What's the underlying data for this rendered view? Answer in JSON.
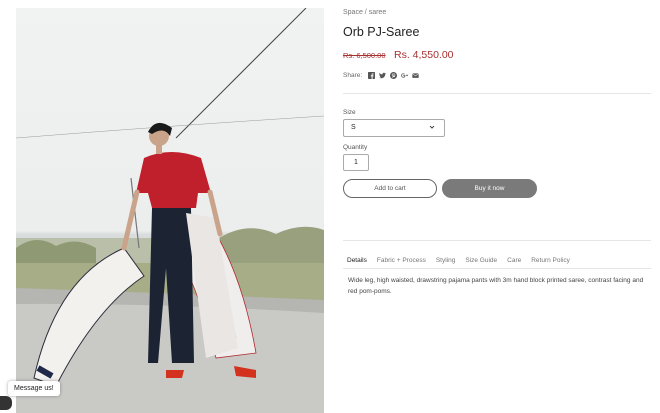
{
  "breadcrumb": {
    "parent": "Space",
    "separator": " / ",
    "current": "saree"
  },
  "product": {
    "title": "Orb PJ-Saree",
    "old_price": "Rs. 6,500.00",
    "price": "Rs. 4,550.00"
  },
  "share": {
    "label": "Share:",
    "icons": [
      "facebook-icon",
      "twitter-icon",
      "pinterest-icon",
      "google-plus-icon",
      "email-icon"
    ]
  },
  "size": {
    "label": "Size",
    "selected": "S"
  },
  "quantity": {
    "label": "Quantity",
    "value": "1"
  },
  "buttons": {
    "add_to_cart": "Add to cart",
    "buy_now": "Buy it now"
  },
  "tabs": [
    "Details",
    "Fabric + Process",
    "Styling",
    "Size Guide",
    "Care",
    "Return Policy"
  ],
  "active_tab": "Details",
  "details_text": "Wide leg, high waisted, drawstring pajama pants with 3m hand block printed saree, contrast facing and red pom-poms.",
  "chat": {
    "label": "Message us!"
  },
  "colors": {
    "price": "#a83030",
    "buy_button": "#7a7a7a",
    "blouse": "#c0202c"
  }
}
